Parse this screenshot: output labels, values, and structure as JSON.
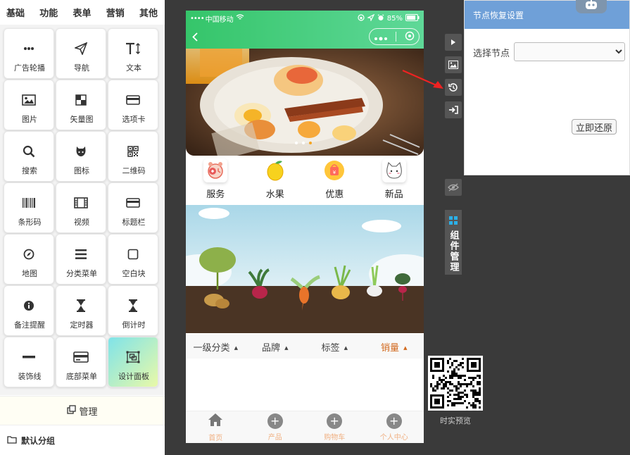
{
  "top_nav": [
    "基础",
    "功能",
    "表单",
    "营销",
    "其他"
  ],
  "components": [
    {
      "label": "广告轮播",
      "icon": "ellipsis-icon"
    },
    {
      "label": "导航",
      "icon": "paper-plane-icon"
    },
    {
      "label": "文本",
      "icon": "text-size-icon"
    },
    {
      "label": "图片",
      "icon": "image-icon"
    },
    {
      "label": "矢量图",
      "icon": "vector-icon"
    },
    {
      "label": "选项卡",
      "icon": "credit-card-icon"
    },
    {
      "label": "搜索",
      "icon": "search-icon"
    },
    {
      "label": "图标",
      "icon": "github-icon"
    },
    {
      "label": "二维码",
      "icon": "qrcode-icon"
    },
    {
      "label": "条形码",
      "icon": "barcode-icon"
    },
    {
      "label": "视频",
      "icon": "film-icon"
    },
    {
      "label": "标题栏",
      "icon": "title-bar-icon"
    },
    {
      "label": "地图",
      "icon": "compass-icon"
    },
    {
      "label": "分类菜单",
      "icon": "list-icon"
    },
    {
      "label": "空白块",
      "icon": "square-icon"
    },
    {
      "label": "备注提醒",
      "icon": "info-icon"
    },
    {
      "label": "定时器",
      "icon": "hourglass-icon"
    },
    {
      "label": "倒计时",
      "icon": "hourglass-icon"
    },
    {
      "label": "装饰线",
      "icon": "minus-icon"
    },
    {
      "label": "底部菜单",
      "icon": "credit-card-icon"
    },
    {
      "label": "设计面板",
      "icon": "object-group-icon"
    }
  ],
  "manage_label": "管理",
  "default_group": "默认分组",
  "phone": {
    "carrier": "中国移动",
    "battery": "85%",
    "categories": [
      {
        "label": "服务",
        "icon": "alarm-clock-icon"
      },
      {
        "label": "水果",
        "icon": "lemon-icon"
      },
      {
        "label": "优惠",
        "icon": "coupon-bag-icon"
      },
      {
        "label": "新品",
        "icon": "cat-icon"
      }
    ],
    "sort_tabs": [
      "一级分类",
      "品牌",
      "标签",
      "销量"
    ],
    "active_sort": "销量",
    "tabbar": [
      {
        "label": "首页",
        "icon": "home-icon"
      },
      {
        "label": "产品",
        "icon": "plus-circle-icon"
      },
      {
        "label": "购物车",
        "icon": "plus-circle-icon"
      },
      {
        "label": "个人中心",
        "icon": "plus-circle-icon"
      }
    ]
  },
  "side_tools": [
    "play-icon",
    "image-icon",
    "history-icon",
    "sign-in-icon"
  ],
  "component_manager_label": "组件管理",
  "qr_caption": "时实预览",
  "restore_panel": {
    "title": "节点恢复设置",
    "select_label": "选择节点",
    "select_value": "",
    "restore_button": "立即还原"
  },
  "colors": {
    "accent_green": "#35c56a",
    "panel_header": "#6fa0d8",
    "active_sort": "#d2691e",
    "annotation_arrow": "#ee2222"
  }
}
